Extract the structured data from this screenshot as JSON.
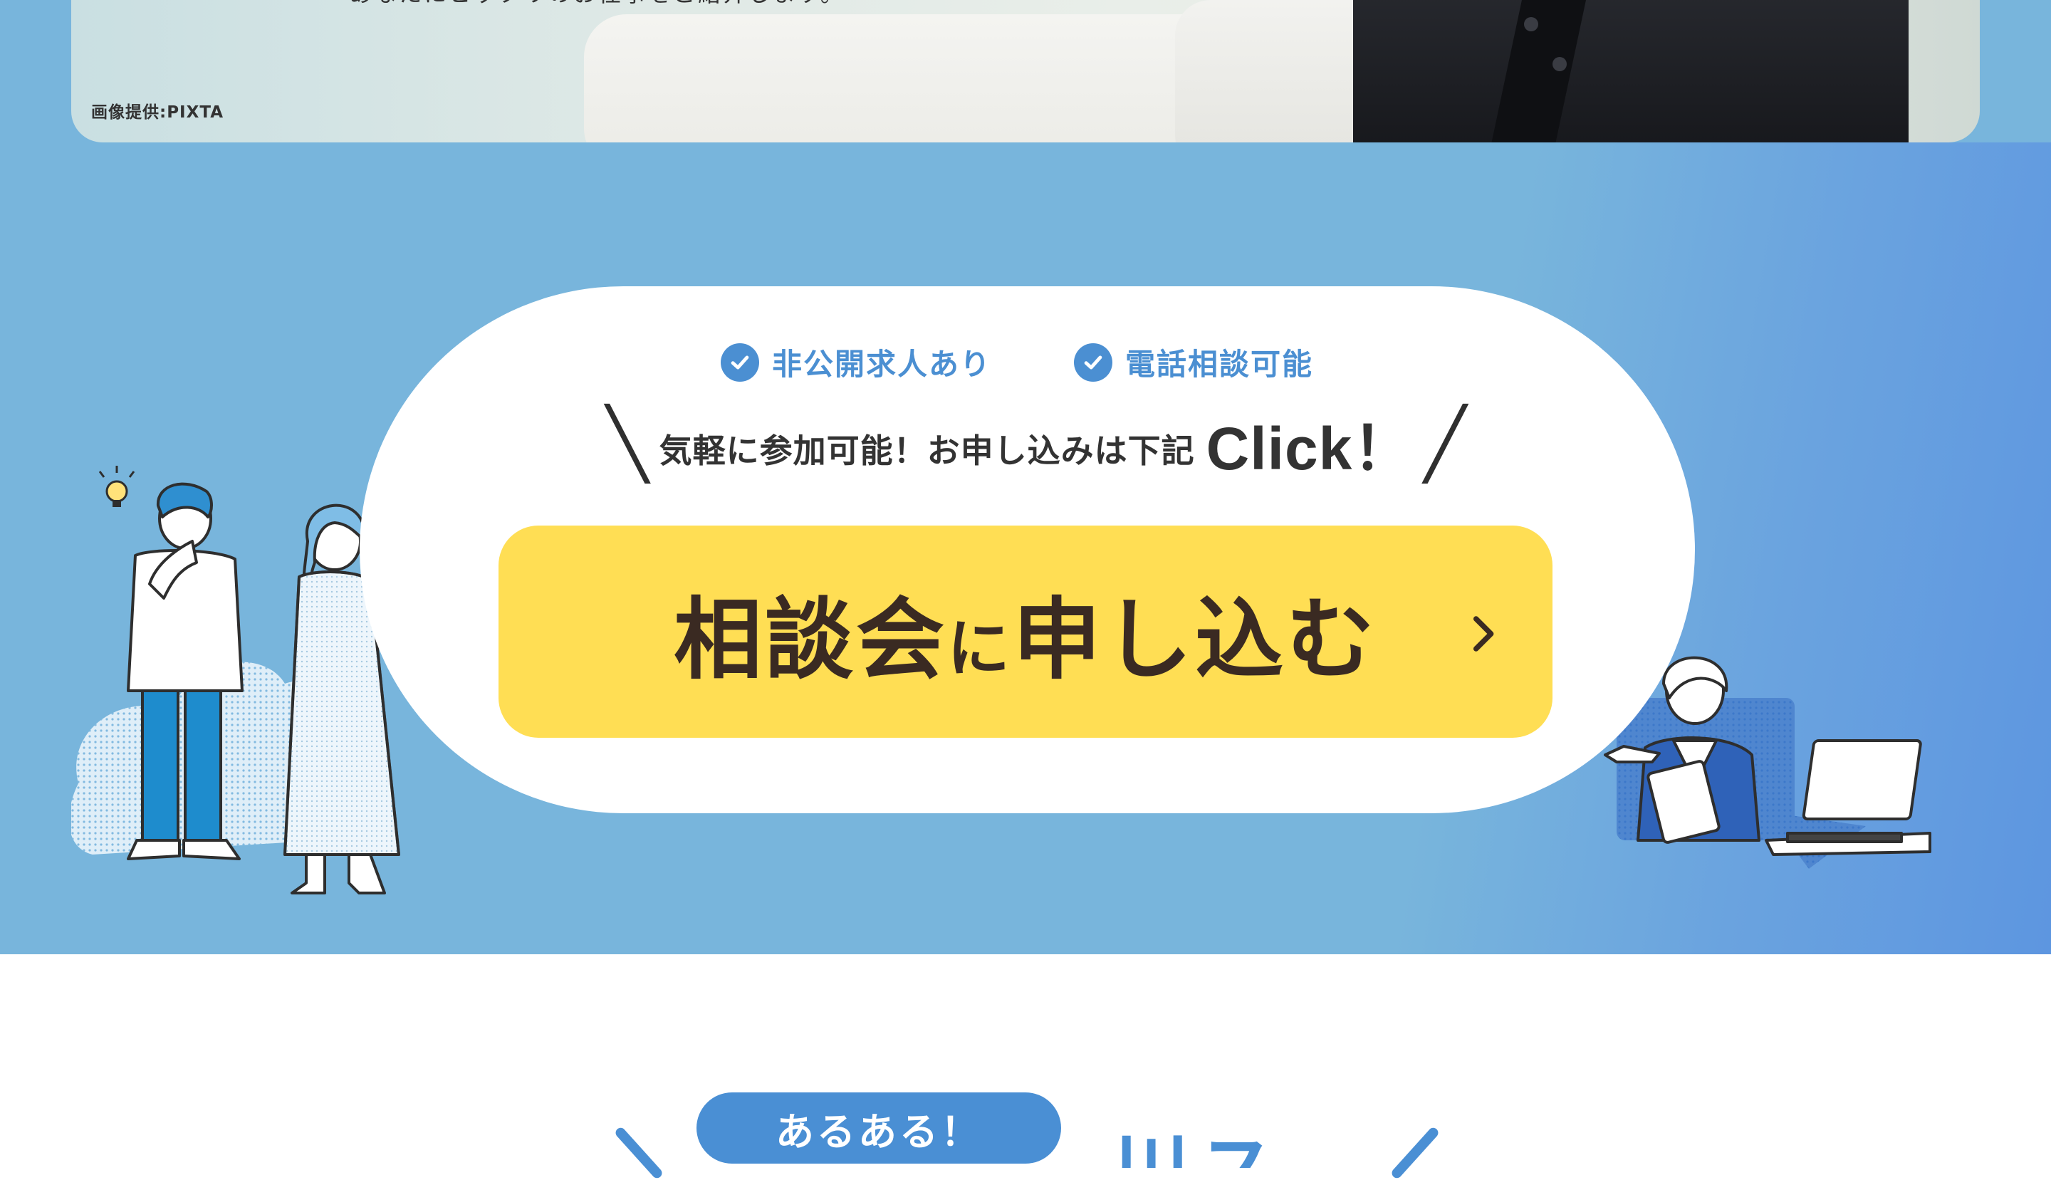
{
  "hero": {
    "caption": "あなたにピッタリのお仕事をご紹介します。",
    "credit": "画像提供:PIXTA"
  },
  "cta": {
    "features": [
      "非公開求人あり",
      "電話相談可能"
    ],
    "lead_text": "気軽に参加可能！お申し込みは下記",
    "lead_click": "Click！",
    "button": {
      "main": "相談会",
      "particle": "に",
      "tail": "申し込む"
    }
  },
  "section": {
    "badge": "あるある！",
    "heading_partial": "川ス"
  },
  "colors": {
    "section_bg": "#78b5dc",
    "accent_blue": "#4b8fd2",
    "button_yellow": "#ffde54",
    "button_text": "#3a2a22"
  },
  "icons": [
    "check-icon",
    "chevron-right-icon",
    "lightbulb-icon",
    "heart-icon"
  ]
}
